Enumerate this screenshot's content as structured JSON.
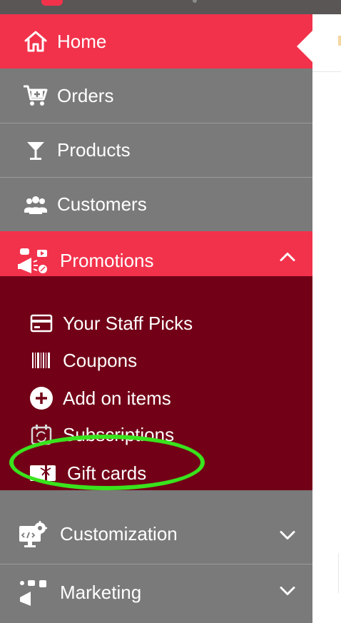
{
  "nav": {
    "home": {
      "label": "Home",
      "icon": "home-icon"
    },
    "orders": {
      "label": "Orders",
      "icon": "cart-add-icon"
    },
    "products": {
      "label": "Products",
      "icon": "cocktail-glass-icon"
    },
    "customers": {
      "label": "Customers",
      "icon": "users-icon"
    },
    "promotions": {
      "label": "Promotions",
      "icon": "promotions-icon",
      "expanded": true
    },
    "customization": {
      "label": "Customization",
      "icon": "customization-icon",
      "expanded": false
    },
    "marketing": {
      "label": "Marketing",
      "icon": "marketing-icon",
      "expanded": false
    }
  },
  "promotions_submenu": [
    {
      "label": "Your Staff Picks",
      "icon": "credit-card-icon"
    },
    {
      "label": "Coupons",
      "icon": "barcode-icon"
    },
    {
      "label": "Add on items",
      "icon": "plus-circle-icon"
    },
    {
      "label": "Subscriptions",
      "icon": "calendar-refresh-icon"
    },
    {
      "label": "Gift cards",
      "icon": "gift-card-icon"
    }
  ],
  "colors": {
    "active": "#f2324b",
    "sidebar": "#7a7a7a",
    "submenu": "#720017",
    "highlight": "#39e31d"
  }
}
